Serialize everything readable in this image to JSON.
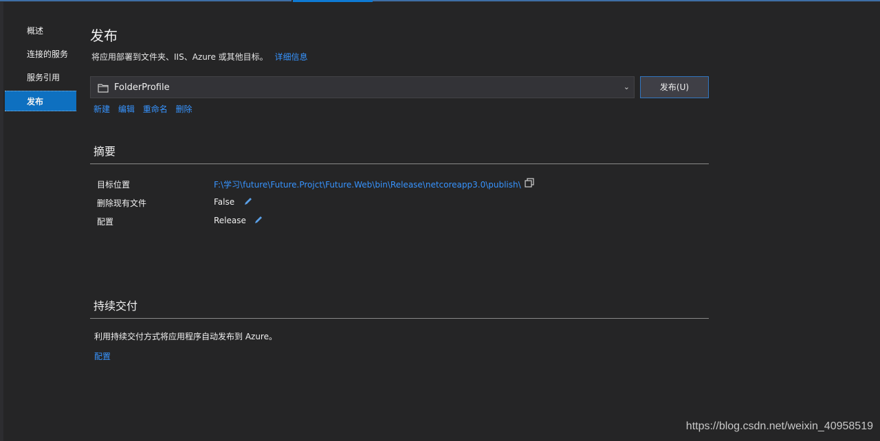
{
  "nav": {
    "items": [
      {
        "label": "概述"
      },
      {
        "label": "连接的服务"
      },
      {
        "label": "服务引用"
      },
      {
        "label": "发布",
        "active": true
      }
    ]
  },
  "header": {
    "title": "发布",
    "subtitle": "将应用部署到文件夹、IIS、Azure 或其他目标。",
    "details_link": "详细信息"
  },
  "profile": {
    "selected": "FolderProfile",
    "publish_button": "发布(U)",
    "actions": [
      "新建",
      "编辑",
      "重命名",
      "删除"
    ]
  },
  "summary": {
    "title": "摘要",
    "rows": [
      {
        "label": "目标位置",
        "value": "F:\\学习\\future\\Future.Projct\\Future.Web\\bin\\Release\\netcoreapp3.0\\publish\\",
        "icon": "copy-icon"
      },
      {
        "label": "删除现有文件",
        "value": "False",
        "icon": "edit-icon"
      },
      {
        "label": "配置",
        "value": "Release",
        "icon": "edit-icon"
      }
    ]
  },
  "continuous_delivery": {
    "title": "持续交付",
    "text": "利用持续交付方式将应用程序自动发布到 Azure。",
    "configure_link": "配置"
  },
  "watermark": "https://blog.csdn.net/weixin_40958519",
  "colors": {
    "background": "#252526",
    "link": "#3794ff",
    "active_nav": "#0e70c0",
    "accent_border": "#3277c2"
  }
}
